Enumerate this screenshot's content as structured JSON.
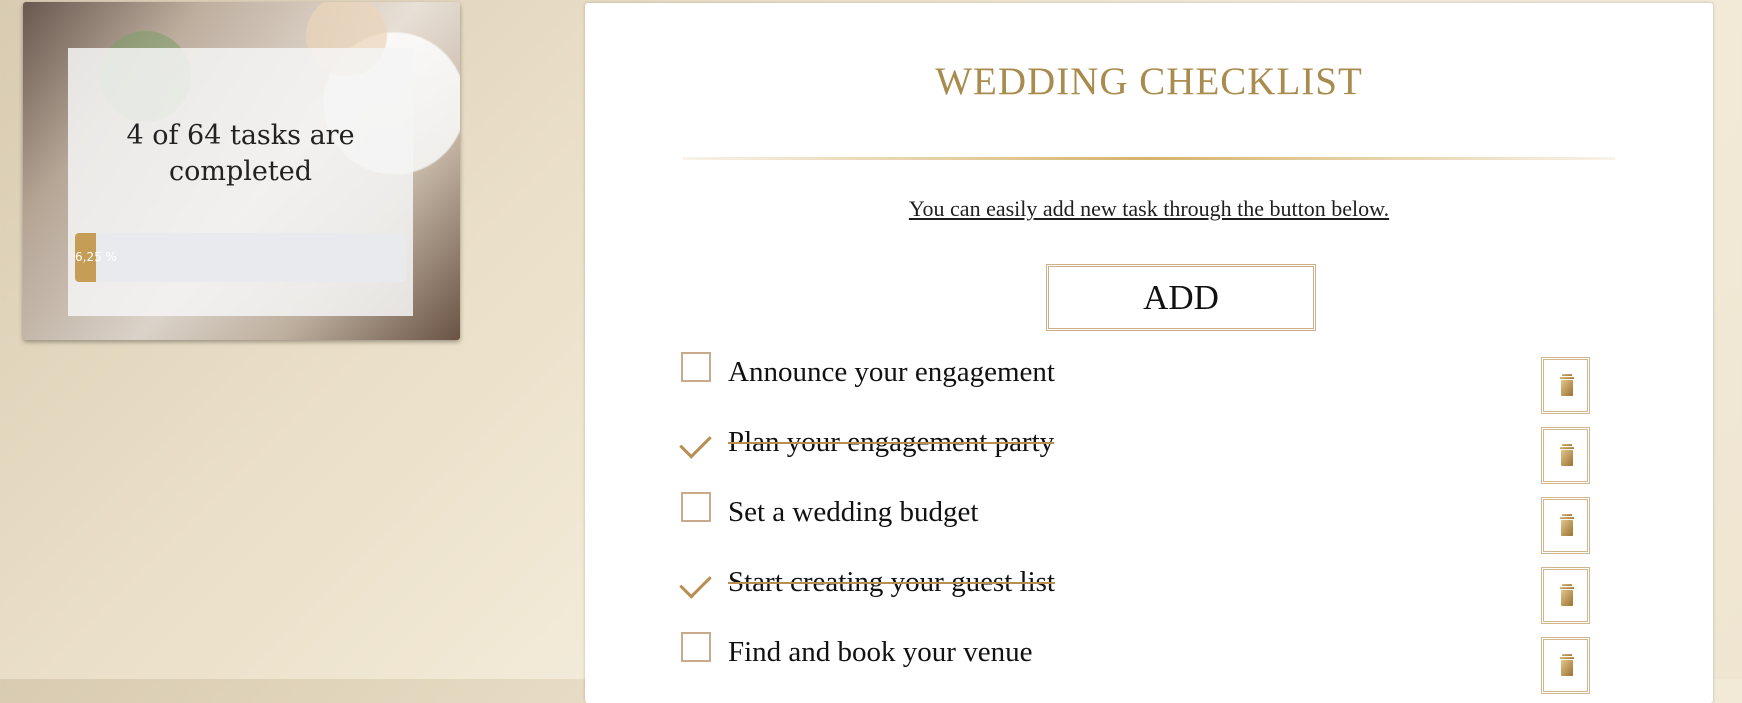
{
  "progress": {
    "text": "4 of 64 tasks are completed",
    "percent_label": "6,25 %",
    "percent": 6.25,
    "fill_color": "#c69d57"
  },
  "checklist": {
    "title": "WEDDING CHECKLIST",
    "hint": "You can easily add new task through the button below.",
    "add_label": "ADD",
    "tasks": [
      {
        "label": "Announce your engagement",
        "done": false
      },
      {
        "label": "Plan your engagement party",
        "done": true
      },
      {
        "label": "Set a wedding budget",
        "done": false
      },
      {
        "label": "Start creating your guest list",
        "done": true
      },
      {
        "label": "Find and book your venue",
        "done": false
      }
    ]
  },
  "colors": {
    "accent": "#b98e51",
    "title": "#a88b4d",
    "background": "#efe5d1"
  },
  "icons": {
    "delete": "trash-icon",
    "checked": "checkmark-icon",
    "unchecked": "checkbox-icon"
  }
}
